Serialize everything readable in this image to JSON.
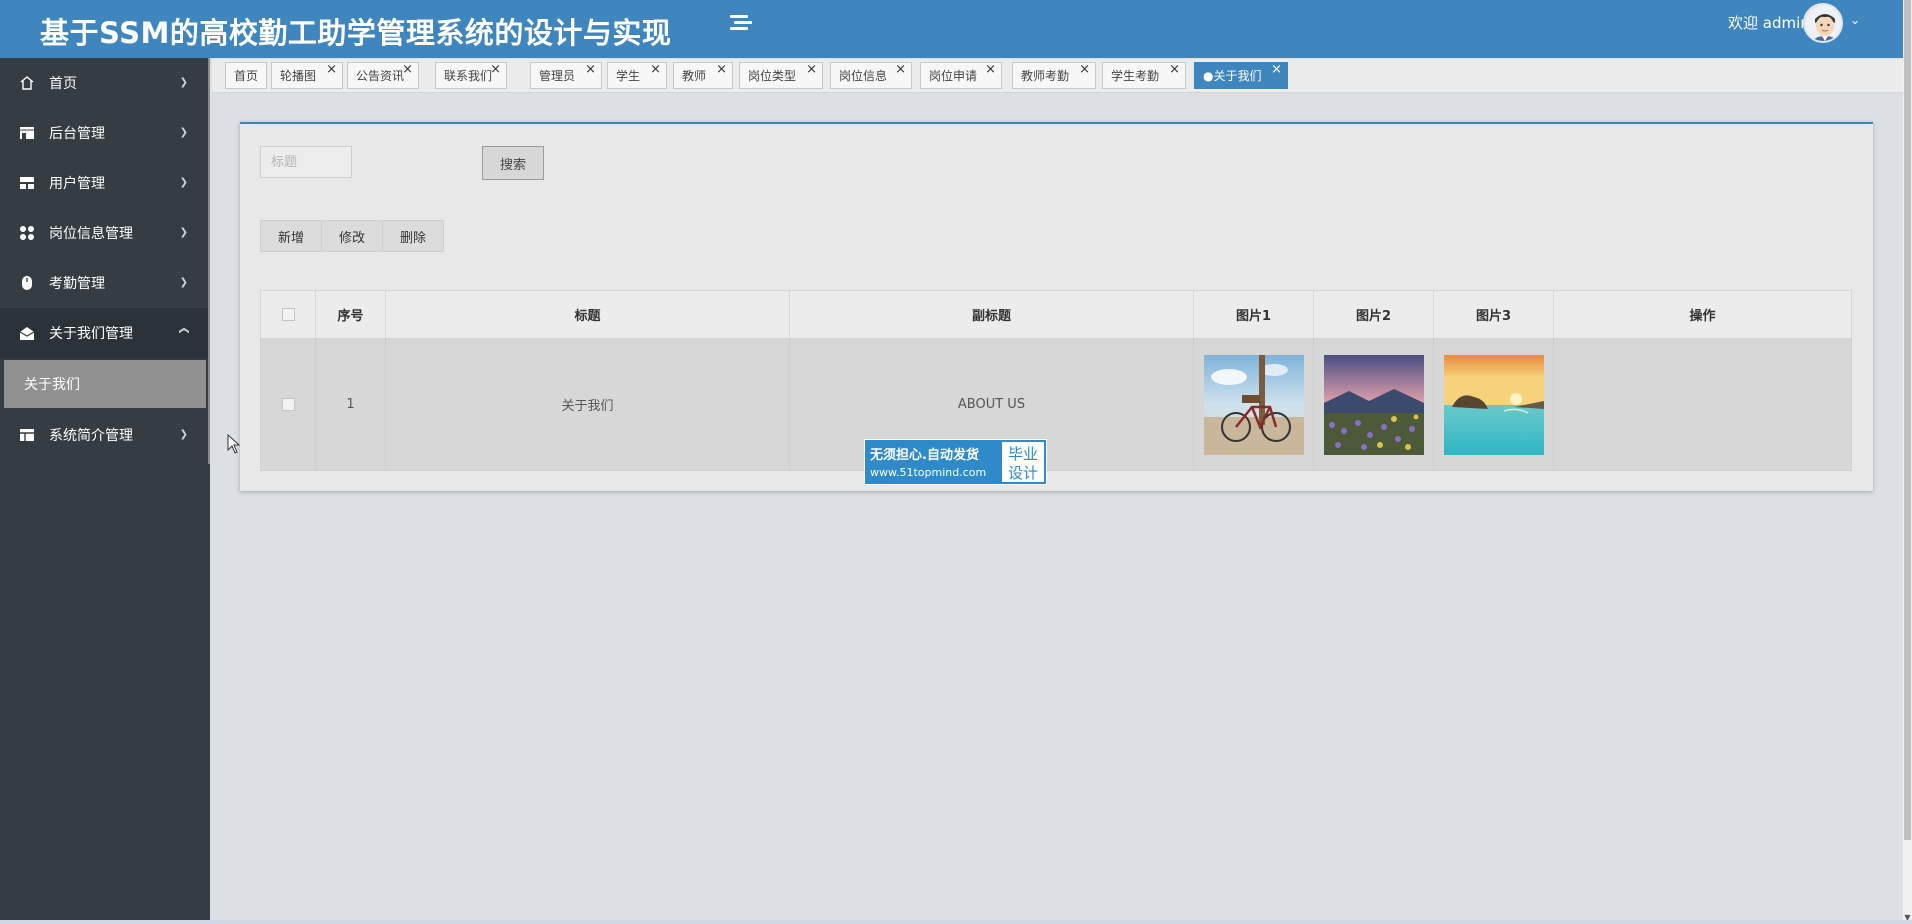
{
  "header": {
    "title": "基于SSM的高校勤工助学管理系统的设计与实现",
    "welcome": "欢迎 admin"
  },
  "sidebar": {
    "items": [
      {
        "label": "首页",
        "icon": "home-icon"
      },
      {
        "label": "后台管理",
        "icon": "store-icon"
      },
      {
        "label": "用户管理",
        "icon": "grid-icon"
      },
      {
        "label": "岗位信息管理",
        "icon": "apps-icon"
      },
      {
        "label": "考勤管理",
        "icon": "mouse-icon"
      },
      {
        "label": "关于我们管理",
        "icon": "mail-open-icon",
        "open": true,
        "children": [
          {
            "label": "关于我们"
          }
        ]
      },
      {
        "label": "系统简介管理",
        "icon": "table-icon"
      }
    ]
  },
  "tabs": [
    {
      "label": "首页"
    },
    {
      "label": "轮播图"
    },
    {
      "label": "公告资讯"
    },
    {
      "label": "联系我们"
    },
    {
      "label": "管理员"
    },
    {
      "label": "学生"
    },
    {
      "label": "教师"
    },
    {
      "label": "岗位类型"
    },
    {
      "label": "岗位信息"
    },
    {
      "label": "岗位申请"
    },
    {
      "label": "教师考勤"
    },
    {
      "label": "学生考勤"
    },
    {
      "label": "●关于我们",
      "active": true
    }
  ],
  "search": {
    "placeholder": "标题",
    "button": "搜索"
  },
  "actions": {
    "add": "新增",
    "edit": "修改",
    "delete": "删除"
  },
  "table": {
    "headers": [
      "序号",
      "标题",
      "副标题",
      "图片1",
      "图片2",
      "图片3",
      "操作"
    ],
    "rows": [
      {
        "index": "1",
        "title": "关于我们",
        "subtitle": "ABOUT US"
      }
    ]
  },
  "watermark": {
    "line1": "无须担心.自动发货",
    "line2": "www.51topmind.com",
    "right1": "毕业",
    "right2": "设计"
  },
  "colors": {
    "header": "#3e86bd",
    "sidebar": "#353d42",
    "active_tab": "#3e86bd"
  }
}
